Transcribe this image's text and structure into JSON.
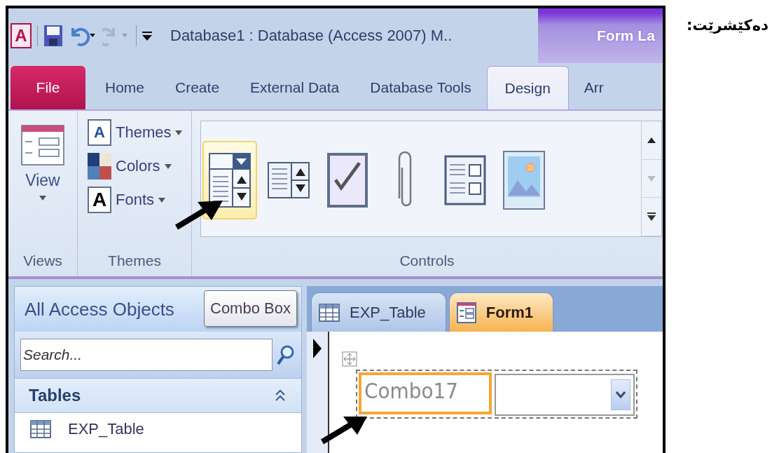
{
  "window": {
    "logo": "A",
    "title": "Database1 : Database (Access 2007) M..",
    "contextual_tab": "Form La"
  },
  "ribbon_tabs": [
    {
      "label": "File",
      "kind": "file",
      "selected": false
    },
    {
      "label": "Home",
      "kind": "tab",
      "selected": false
    },
    {
      "label": "Create",
      "kind": "tab",
      "selected": false
    },
    {
      "label": "External Data",
      "kind": "tab",
      "selected": false
    },
    {
      "label": "Database Tools",
      "kind": "tab",
      "selected": false
    },
    {
      "label": "Design",
      "kind": "tab",
      "selected": true
    },
    {
      "label": "Arr",
      "kind": "tab",
      "selected": false
    }
  ],
  "ribbon": {
    "views": {
      "button": "View",
      "label": "Views"
    },
    "themes": {
      "label": "Themes",
      "items": [
        {
          "label": "Themes",
          "kind": "themes",
          "glyph": "A"
        },
        {
          "label": "Colors",
          "kind": "colors"
        },
        {
          "label": "Fonts",
          "kind": "fonts",
          "glyph": "A"
        }
      ]
    },
    "controls": {
      "label": "Controls",
      "items": [
        {
          "kind": "combo-box",
          "selected": true
        },
        {
          "kind": "list-box",
          "selected": false
        },
        {
          "kind": "check-box",
          "selected": false
        },
        {
          "kind": "attachment",
          "selected": false
        },
        {
          "kind": "subform",
          "selected": false
        },
        {
          "kind": "image",
          "selected": false
        }
      ]
    }
  },
  "tooltip": "Combo Box",
  "navigation": {
    "title": "All Access Objects",
    "search": {
      "placeholder": "Search..."
    },
    "groups": [
      {
        "title": "Tables",
        "expanded": true,
        "items": [
          "EXP_Table"
        ]
      }
    ]
  },
  "document_tabs": [
    {
      "label": "EXP_Table",
      "kind": "table",
      "selected": false
    },
    {
      "label": "Form1",
      "kind": "form",
      "selected": true
    }
  ],
  "form": {
    "label": "Combo17",
    "label_selected": true
  },
  "caption": "دەکێشرێت:"
}
